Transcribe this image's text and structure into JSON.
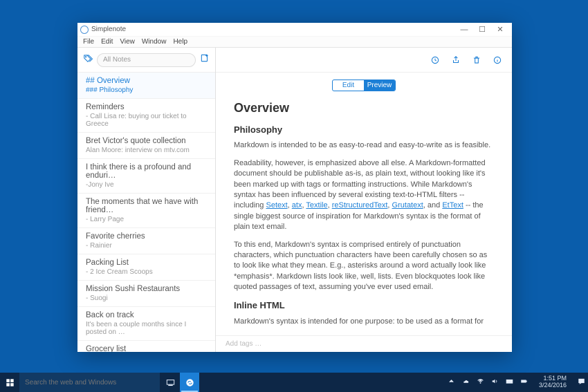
{
  "window": {
    "title": "Simplenote"
  },
  "menubar": [
    "File",
    "Edit",
    "View",
    "Window",
    "Help"
  ],
  "search": {
    "placeholder": "All Notes"
  },
  "notes": [
    {
      "title": "## Overview",
      "subtitle": "### Philosophy",
      "active": true
    },
    {
      "title": "Reminders",
      "subtitle": "- Call Lisa re: buying our ticket to Greece"
    },
    {
      "title": "Bret Victor's quote collection",
      "subtitle": "Alan Moore: interview on mtv.com"
    },
    {
      "title": "I think there is a profound and enduri…",
      "subtitle": "-Jony Ive"
    },
    {
      "title": "The moments that we have with friend…",
      "subtitle": "- Larry Page"
    },
    {
      "title": "Favorite cherries",
      "subtitle": "- Rainier"
    },
    {
      "title": "Packing List",
      "subtitle": "- 2 Ice Cream Scoops"
    },
    {
      "title": "Mission Sushi Restaurants",
      "subtitle": "- Suogi"
    },
    {
      "title": "Back on track",
      "subtitle": "It's been a couple months since I posted on …"
    },
    {
      "title": "Grocery list",
      "subtitle": ""
    }
  ],
  "toggle": {
    "edit": "Edit",
    "preview": "Preview"
  },
  "doc": {
    "h1": "Overview",
    "h2a": "Philosophy",
    "p1": "Markdown is intended to be as easy-to-read and easy-to-write as is feasible.",
    "p2a": "Readability, however, is emphasized above all else. A Markdown-formatted document should be publishable as-is, as plain text, without looking like it's been marked up with tags or formatting instructions. While Markdown's syntax has been influenced by several existing text-to-HTML filters -- including ",
    "l1": "Setext",
    "c1": ", ",
    "l2": "atx",
    "c2": ", ",
    "l3": "Textile",
    "c3": ", ",
    "l4": "reStructuredText",
    "c4": ", ",
    "l5": "Grutatext",
    "c5": ", and ",
    "l6": "EtText",
    "p2b": " -- the single biggest source of inspiration for Markdown's syntax is the format of plain text email.",
    "p3": "To this end, Markdown's syntax is comprised entirely of punctuation characters, which punctuation characters have been carefully chosen so as to look like what they mean. E.g., asterisks around a word actually look like *emphasis*. Markdown lists look like, well, lists. Even blockquotes look like quoted passages of text, assuming you've ever used email.",
    "h2b": "Inline HTML",
    "p4": "Markdown's syntax is intended for one purpose: to be used as a format for"
  },
  "tag_row": "Add tags …",
  "taskbar": {
    "search_placeholder": "Search the web and Windows",
    "time": "1:51 PM",
    "date": "3/24/2016"
  }
}
